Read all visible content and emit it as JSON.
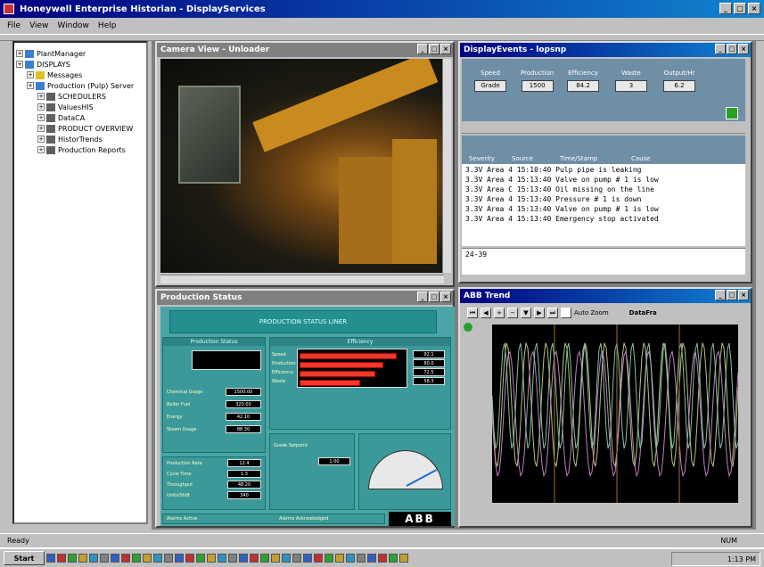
{
  "app": {
    "title": "Honeywell Enterprise Historian - DisplayServices",
    "menu": [
      "File",
      "View",
      "Window",
      "Help"
    ]
  },
  "tree": {
    "items": [
      {
        "label": "PlantManager",
        "indent": 0,
        "color": "#3a7fd0"
      },
      {
        "label": "DISPLAYS",
        "indent": 0,
        "color": "#3a7fd0"
      },
      {
        "label": "Messages",
        "indent": 1,
        "color": "#e0c020"
      },
      {
        "label": "Production (Pulp) Server",
        "indent": 1,
        "color": "#3a7fd0"
      },
      {
        "label": "SCHEDULERS",
        "indent": 2,
        "color": "#606060"
      },
      {
        "label": "ValuesHIS",
        "indent": 2,
        "color": "#606060"
      },
      {
        "label": "DataCA",
        "indent": 2,
        "color": "#606060"
      },
      {
        "label": "PRODUCT OVERVIEW",
        "indent": 2,
        "color": "#606060"
      },
      {
        "label": "HistorTrends",
        "indent": 2,
        "color": "#606060"
      },
      {
        "label": "Production Reports",
        "indent": 2,
        "color": "#606060"
      }
    ]
  },
  "windows": {
    "video": {
      "title": "Camera View - Unloader"
    },
    "display": {
      "title": "DisplayEvents - lopsnp",
      "params": [
        {
          "label": "Speed",
          "value": "Grade"
        },
        {
          "label": "Production",
          "value": "1500"
        },
        {
          "label": "Efficiency",
          "value": "84.2"
        },
        {
          "label": "Waste",
          "value": "3"
        },
        {
          "label": "Output/Hr",
          "value": "6.2"
        }
      ],
      "columns": [
        "Severity",
        "Source",
        "Time/Stamp",
        "Cause"
      ],
      "events": [
        "3.3V Area 4  15:10:40  Pulp pipe is leaking",
        "3.3V Area 4  15:13:40  Valve on pump # 1 is low",
        "3.3V Area C  15:13:40  Oil missing on the line",
        "3.3V Area 4  15:13:40  Pressure # 1 is down",
        "3.3V Area 4  15:13:40  Valve on pump # 1 is low",
        "3.3V Area 4  15:13:40  Emergency stop activated"
      ],
      "command": "24-39"
    },
    "production": {
      "title": "Production Status",
      "heading": "PRODUCTION STATUS LINER",
      "left_section": "Production Status",
      "right_section": "Efficiency",
      "bars": [
        {
          "label": "Speed",
          "value": 92
        },
        {
          "label": "Production",
          "value": 80
        },
        {
          "label": "Efficiency",
          "value": 72
        },
        {
          "label": "Waste",
          "value": 58
        }
      ],
      "bar_values": [
        "92.1",
        "80.0",
        "72.5",
        "58.3"
      ],
      "left_labels": [
        "Chemical Usage",
        "Boiler Fuel",
        "Energy",
        "Steam Usage"
      ],
      "left_values": [
        "1500.00",
        "320.00",
        "42.10",
        "88.30"
      ],
      "mid_labels": [
        "Production Rate",
        "Cycle Time",
        "Throughput",
        "Units/Shift",
        "Grade Setpoint"
      ],
      "mid_values": [
        "12.4",
        "1.3",
        "48.20",
        "340",
        "1.00"
      ],
      "bottom_labels": [
        "Alarms Active",
        "Alarms Acknowledged"
      ],
      "logo": "ABB"
    },
    "trend": {
      "title": "ABB Trend",
      "checkbox_label": "Auto Zoom",
      "right_label": "DataFra"
    }
  },
  "status": {
    "left": "Ready",
    "right": "NUM"
  },
  "taskbar": {
    "start": "Start",
    "clock": "1:13 PM"
  }
}
